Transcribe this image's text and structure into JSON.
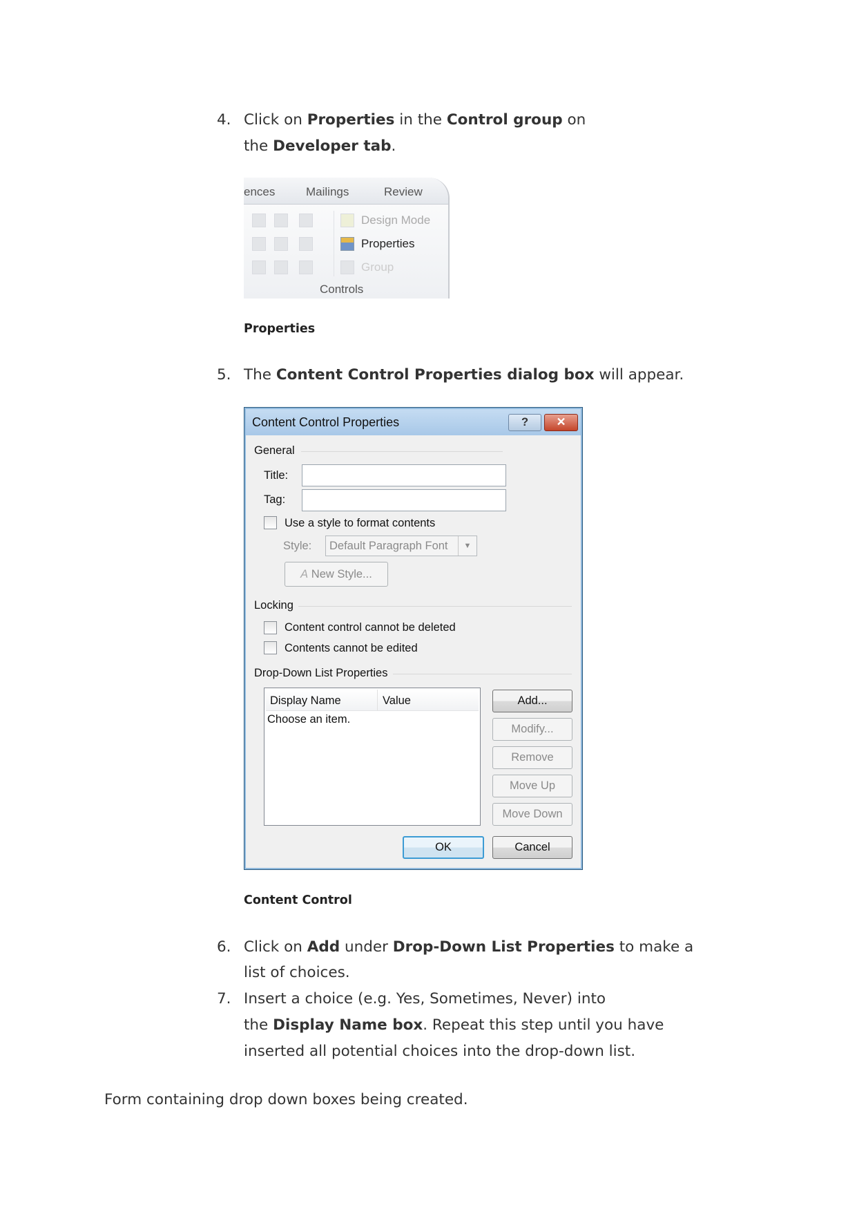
{
  "steps": [
    {
      "number": "4.",
      "lines": [
        [
          {
            "t": "Click on "
          },
          {
            "t": "Properties",
            "b": true
          },
          {
            "t": " in the "
          },
          {
            "t": "Control group",
            "b": true
          },
          {
            "t": " on"
          }
        ],
        [
          {
            "t": "the "
          },
          {
            "t": "Developer tab",
            "b": true
          },
          {
            "t": "."
          }
        ]
      ]
    },
    {
      "number": "5.",
      "lines": [
        [
          {
            "t": "The "
          },
          {
            "t": "Content Control Properties dialog box",
            "b": true
          },
          {
            "t": " will appear."
          }
        ]
      ]
    },
    {
      "number": "6.",
      "lines": [
        [
          {
            "t": "Click on "
          },
          {
            "t": "Add",
            "b": true
          },
          {
            "t": " under "
          },
          {
            "t": "Drop-Down List Properties",
            "b": true
          },
          {
            "t": " to make a"
          }
        ],
        [
          {
            "t": "list of choices."
          }
        ]
      ]
    },
    {
      "number": "7.",
      "lines": [
        [
          {
            "t": "Insert a choice (e.g. Yes, Sometimes, Never) into"
          }
        ],
        [
          {
            "t": "the "
          },
          {
            "t": "Display Name box",
            "b": true
          },
          {
            "t": ". Repeat this step until you have"
          }
        ],
        [
          {
            "t": "inserted all potential choices into the drop-down list."
          }
        ]
      ]
    }
  ],
  "ribbon": {
    "tabs": [
      "ences",
      "Mailings",
      "Review"
    ],
    "design_mode": "Design Mode",
    "properties": "Properties",
    "group_button": "Group",
    "group_label": "Controls"
  },
  "captions": {
    "ribbon": "Properties",
    "dialog": "Content Control"
  },
  "dialog": {
    "title": "Content Control Properties",
    "help_label": "?",
    "close_label": "✕",
    "general": "General",
    "title_label": "Title:",
    "title_value": "",
    "tag_label": "Tag:",
    "tag_value": "",
    "use_style": "Use a style to format contents",
    "use_style_checked": false,
    "style_label": "Style:",
    "style_value": "Default Paragraph Font",
    "new_style": "New Style...",
    "locking": "Locking",
    "cannot_delete": "Content control cannot be deleted",
    "cannot_edit": "Contents cannot be edited",
    "dropdown_section": "Drop-Down List Properties",
    "columns": [
      "Display Name",
      "Value"
    ],
    "items": [
      {
        "display": "Choose an item.",
        "value": ""
      }
    ],
    "buttons": {
      "add": "Add...",
      "modify": "Modify...",
      "remove": "Remove",
      "move_up": "Move Up",
      "move_down": "Move Down"
    },
    "ok": "OK",
    "cancel": "Cancel",
    "colors": {
      "titlebar": "#b5d0ec",
      "close": "#c4452b"
    }
  },
  "footer_text": "Form containing drop down boxes being created."
}
